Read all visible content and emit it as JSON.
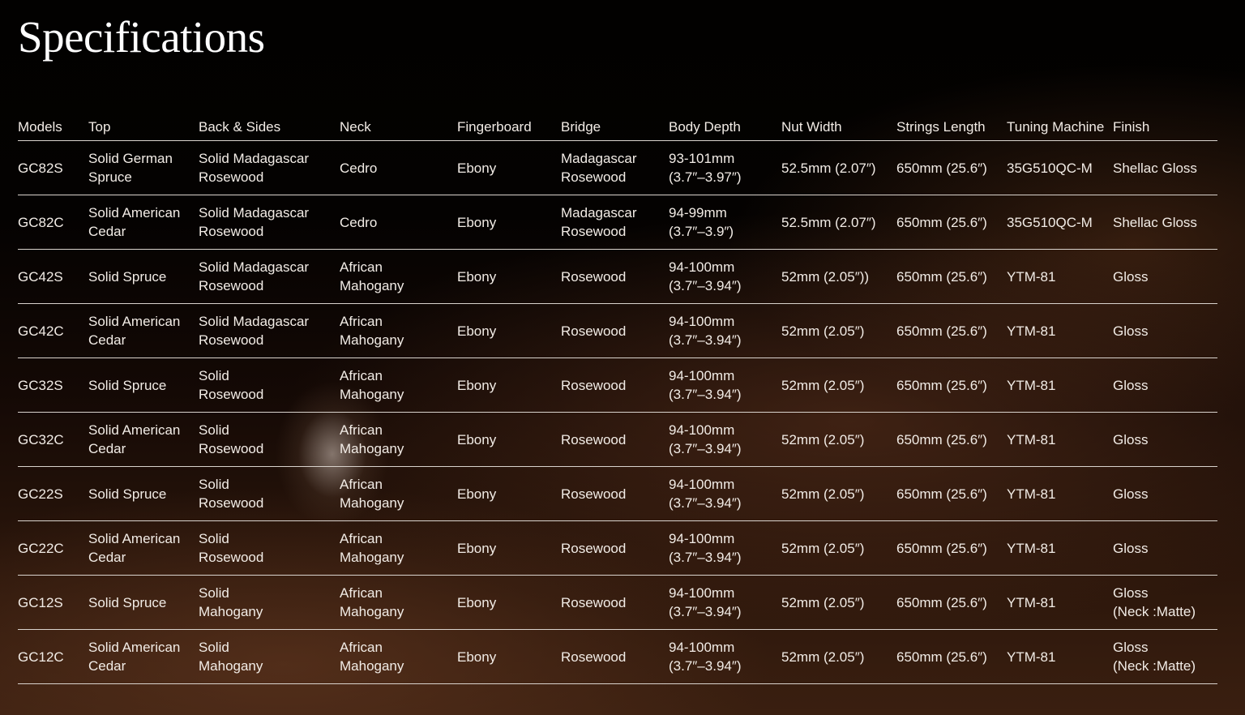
{
  "page": {
    "title": "Specifications"
  },
  "table": {
    "headers": [
      "Models",
      "Top",
      "Back & Sides",
      "Neck",
      "Fingerboard",
      "Bridge",
      "Body Depth",
      "Nut Width",
      "Strings Length",
      "Tuning Machine",
      "Finish"
    ],
    "rows": [
      [
        "GC82S",
        "Solid German\nSpruce",
        "Solid Madagascar\nRosewood",
        "Cedro",
        "Ebony",
        "Madagascar\nRosewood",
        "93-101mm\n(3.7″–3.97″)",
        "52.5mm (2.07″)",
        "650mm (25.6″)",
        "35G510QC-M",
        "Shellac Gloss"
      ],
      [
        "GC82C",
        "Solid American\nCedar",
        "Solid Madagascar\nRosewood",
        "Cedro",
        "Ebony",
        "Madagascar\nRosewood",
        "94-99mm\n (3.7″–3.9″)",
        "52.5mm (2.07″)",
        "650mm (25.6″)",
        "35G510QC-M",
        "Shellac Gloss"
      ],
      [
        "GC42S",
        "Solid Spruce",
        "Solid Madagascar\nRosewood",
        "African\nMahogany",
        "Ebony",
        "Rosewood",
        "94-100mm\n(3.7″–3.94″)",
        "52mm (2.05″))",
        "650mm (25.6″)",
        "YTM-81",
        "Gloss"
      ],
      [
        "GC42C",
        "Solid American\nCedar",
        "Solid Madagascar\nRosewood",
        "African\nMahogany",
        "Ebony",
        "Rosewood",
        "94-100mm\n(3.7″–3.94″)",
        "52mm (2.05″)",
        "650mm (25.6″)",
        "YTM-81",
        "Gloss"
      ],
      [
        "GC32S",
        "Solid Spruce",
        "Solid\nRosewood",
        "African\nMahogany",
        "Ebony",
        "Rosewood",
        "94-100mm\n (3.7″–3.94″)",
        "52mm (2.05″)",
        "650mm (25.6″)",
        "YTM-81",
        "Gloss"
      ],
      [
        "GC32C",
        "Solid American\nCedar",
        "Solid\nRosewood",
        "African\nMahogany",
        "Ebony",
        "Rosewood",
        "94-100mm\n(3.7″–3.94″)",
        "52mm (2.05″)",
        "650mm (25.6″)",
        "YTM-81",
        "Gloss"
      ],
      [
        "GC22S",
        "Solid Spruce",
        "Solid\nRosewood",
        "African\nMahogany",
        "Ebony",
        "Rosewood",
        "94-100mm\n(3.7″–3.94″)",
        "52mm (2.05″)",
        "650mm (25.6″)",
        "YTM-81",
        "Gloss"
      ],
      [
        "GC22C",
        "Solid American\nCedar",
        "Solid\nRosewood",
        "African\nMahogany",
        "Ebony",
        "Rosewood",
        "94-100mm\n (3.7″–3.94″)",
        "52mm (2.05″)",
        "650mm (25.6″)",
        "YTM-81",
        " Gloss"
      ],
      [
        "GC12S",
        "Solid Spruce",
        "Solid\nMahogany",
        "African\nMahogany",
        "Ebony",
        "Rosewood",
        "94-100mm\n (3.7″–3.94″)",
        "52mm (2.05″)",
        "650mm (25.6″)",
        "YTM-81",
        "Gloss\n(Neck :Matte)"
      ],
      [
        "GC12C",
        "Solid American\nCedar",
        "Solid\nMahogany",
        "African\nMahogany",
        "Ebony",
        "Rosewood",
        "94-100mm\n (3.7″–3.94″)",
        "52mm (2.05″)",
        "650mm (25.6″)",
        "YTM-81",
        "Gloss\n(Neck :Matte)"
      ]
    ]
  }
}
